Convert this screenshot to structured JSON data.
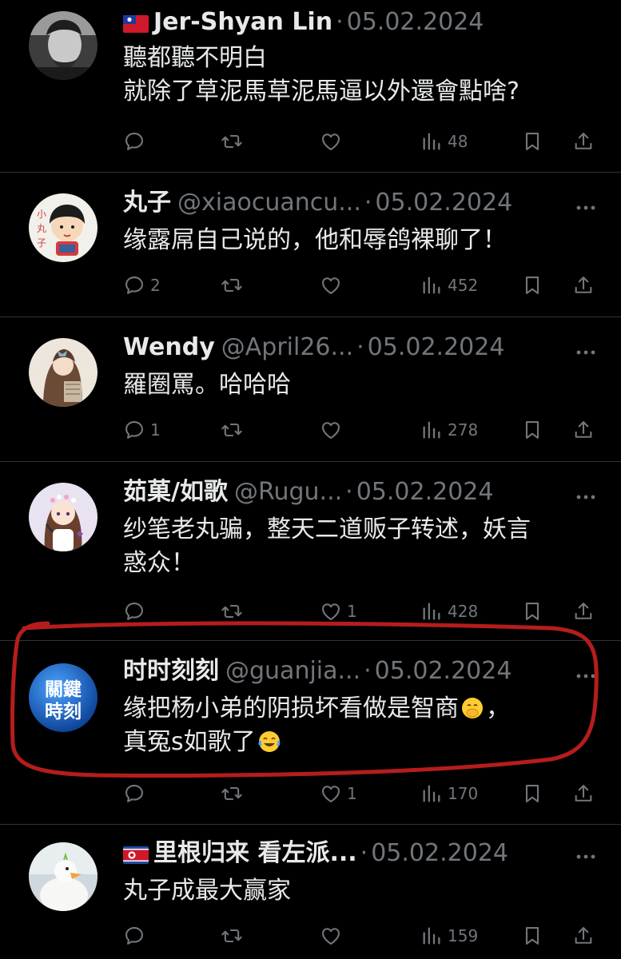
{
  "colors": {
    "background": "#000000",
    "text": "#e7e9ea",
    "muted": "#71767b",
    "divider": "#2f3336",
    "annotation": "#b51d1d"
  },
  "tweets": [
    {
      "flag": "taiwan-flag",
      "name": "Jer-Shyan Lin",
      "handle": "",
      "date": "05.02.2024",
      "lines": [
        "聽都聽不明白",
        "就除了草泥馬草泥馬逼以外還會點啥?"
      ],
      "replies": "",
      "retweets": "",
      "likes": "",
      "views": "48",
      "avatar": "man-photo-avatar"
    },
    {
      "flag": "",
      "name": "丸子",
      "handle": "@xiaocuancu...",
      "date": "05.02.2024",
      "lines": [
        "缘露屌自己说的，他和辱鸽裸聊了！"
      ],
      "replies": "2",
      "retweets": "",
      "likes": "",
      "views": "452",
      "avatar": "cartoon-girl-avatar"
    },
    {
      "flag": "",
      "name": "Wendy",
      "handle": "@April26...",
      "date": "05.02.2024",
      "lines": [
        "羅圈罵。哈哈哈"
      ],
      "replies": "1",
      "retweets": "",
      "likes": "",
      "views": "278",
      "avatar": "long-hair-girl-avatar"
    },
    {
      "flag": "",
      "name": "茹菓/如歌",
      "handle": "@Rugu...",
      "date": "05.02.2024",
      "lines": [
        "纱笔老丸骗，整天二道贩子转述，妖言",
        "惑众！"
      ],
      "replies": "",
      "retweets": "",
      "likes": "1",
      "views": "428",
      "avatar": "anime-singer-avatar"
    },
    {
      "flag": "",
      "name": "时时刻刻",
      "handle": "@guanjia...",
      "date": "05.02.2024",
      "lines": [
        "缘把杨小弟的阴损坏看做是智商",
        "，",
        "真冤s如歌了"
      ],
      "replies": "",
      "retweets": "",
      "likes": "1",
      "views": "170",
      "avatar": "guanjian-shike-logo",
      "avatar_text": [
        "關鍵",
        "時刻"
      ],
      "emoji_1": "face-with-hand-over-mouth-emoji",
      "emoji_2": "tears-of-joy-emoji"
    },
    {
      "flag": "north-korea-flag",
      "name": "里根归来 看左派...",
      "handle": "",
      "date": "05.02.2024",
      "lines": [
        "丸子成最大赢家"
      ],
      "replies": "",
      "retweets": "",
      "likes": "",
      "views": "159",
      "avatar": "white-duck-avatar"
    }
  ],
  "icons": {
    "reply": "reply-icon",
    "retweet": "retweet-icon",
    "like": "like-icon",
    "views": "views-icon",
    "bookmark": "bookmark-icon",
    "share": "share-icon",
    "more": "more-icon"
  }
}
